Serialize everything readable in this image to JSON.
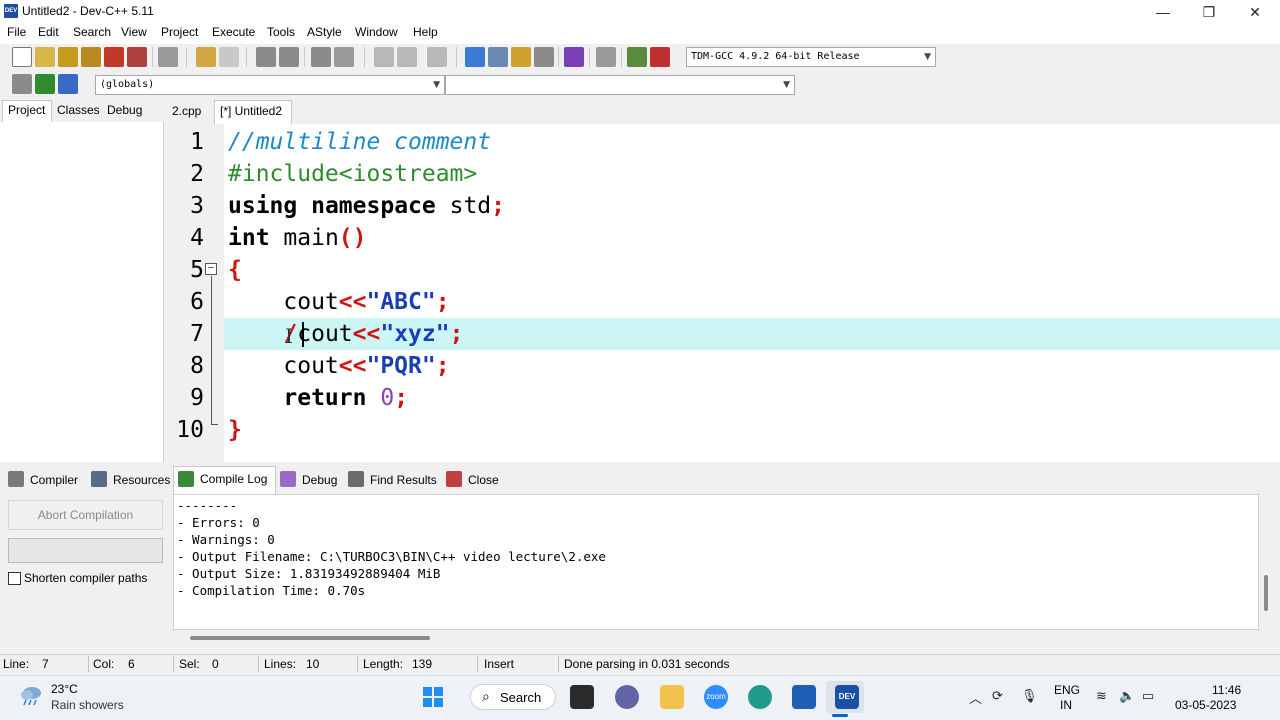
{
  "window": {
    "title": "Untitled2 - Dev-C++ 5.11",
    "app_icon_text": "DEV",
    "minimize_glyph": "—",
    "maximize_glyph": "❐",
    "close_glyph": "✕"
  },
  "menu": [
    "File",
    "Edit",
    "Search",
    "View",
    "Project",
    "Execute",
    "Tools",
    "AStyle",
    "Window",
    "Help"
  ],
  "toolbar": {
    "compiler_select": "TDM-GCC 4.9.2 64-bit Release",
    "globals_select": "(globals)",
    "function_select": ""
  },
  "side_tabs": [
    "Project",
    "Classes",
    "Debug"
  ],
  "editor_tabs": [
    "2.cpp",
    "[*] Untitled2"
  ],
  "code": {
    "line_numbers": [
      "1",
      "2",
      "3",
      "4",
      "5",
      "6",
      "7",
      "8",
      "9",
      "10"
    ],
    "l1": "//multiline comment",
    "l2": "#include<iostream>",
    "l3_kw1": "using",
    "l3_kw2": "namespace",
    "l3_id": "std",
    "l3_semi": ";",
    "l4_kw": "int",
    "l4_id": "main",
    "l4_parens": "()",
    "l5_brace": "{",
    "l6_id": "cout",
    "l6_op": "<<",
    "l6_str": "\"ABC\"",
    "l6_semi": ";",
    "l7_slash": "/",
    "l7_id": "cout",
    "l7_op": "<<",
    "l7_str": "\"xyz\"",
    "l7_semi": ";",
    "l8_id": "cout",
    "l8_op": "<<",
    "l8_str": "\"PQR\"",
    "l8_semi": ";",
    "l9_kw": "return",
    "l9_num": "0",
    "l9_semi": ";",
    "l10_brace": "}",
    "fold_glyph": "−"
  },
  "bottom_tabs": [
    "Compiler",
    "Resources",
    "Compile Log",
    "Debug",
    "Find Results",
    "Close"
  ],
  "compile_panel": {
    "abort_label": "Abort Compilation",
    "shorten_label": "Shorten compiler paths",
    "progress": 0
  },
  "log": [
    "--------",
    "- Errors: 0",
    "- Warnings: 0",
    "- Output Filename: C:\\TURBOC3\\BIN\\C++ video lecture\\2.exe",
    "- Output Size: 1.83193492889404 MiB",
    "- Compilation Time: 0.70s"
  ],
  "status": {
    "line_label": "Line:",
    "line_value": "7",
    "col_label": "Col:",
    "col_value": "6",
    "sel_label": "Sel:",
    "sel_value": "0",
    "lines_label": "Lines:",
    "lines_value": "10",
    "length_label": "Length:",
    "length_value": "139",
    "mode": "Insert",
    "message": "Done parsing in 0.031 seconds"
  },
  "taskbar": {
    "temperature": "23°C",
    "weather": "Rain showers",
    "search_label": "Search",
    "zoom_label": "zoom",
    "devcpp_label": "DEV",
    "lang_line1": "ENG",
    "lang_line2": "IN",
    "time": "11:46",
    "date": "03-05-2023"
  },
  "colors": {
    "current_line": "#ccf5f5",
    "comment": "#1c8ac8",
    "preprocessor": "#2e8b2e",
    "symbol": "#d01414",
    "string": "#1a3fb5",
    "number": "#8b3fb5"
  }
}
